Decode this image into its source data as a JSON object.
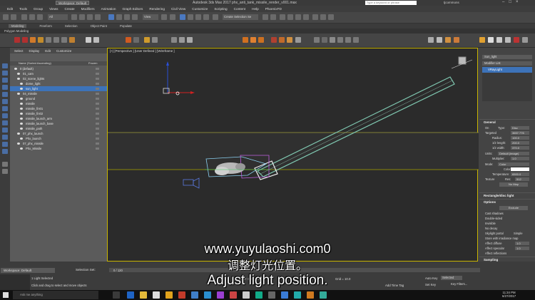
{
  "title_bar": {
    "workspace": "Workspace: Default",
    "title": "Autodesk 3ds Max 2017    phx_anti_tank_missile_render_v001.max",
    "search_placeholder": "Type a keyword or phrase",
    "user": "tjcommons",
    "controls": [
      "–",
      "□",
      "×"
    ]
  },
  "menu": [
    "Edit",
    "Tools",
    "Group",
    "Views",
    "Create",
    "Modifiers",
    "Animation",
    "Graph Editors",
    "Rendering",
    "Civil View",
    "Customize",
    "Scripting",
    "Content",
    "Help",
    "PhoenixFD"
  ],
  "toolbar": {
    "view_dropdown": "All",
    "coord_dropdown": "View",
    "selection_set": "Create Selection Se"
  },
  "ribbon": {
    "tabs": [
      "Modeling",
      "Freeform",
      "Selection",
      "Object Paint",
      "Populate"
    ],
    "active": "Modeling",
    "sub": "Polygon Modeling"
  },
  "scene_explorer": {
    "tabs": [
      "Select",
      "Display",
      "Edit",
      "Customize"
    ],
    "header_name": "Name (Sorted Ascending)",
    "header_frozen": "Frozen",
    "rows": [
      {
        "label": "0 (default)",
        "indent": 0,
        "selected": false
      },
      {
        "label": "01_cam",
        "indent": 1,
        "selected": false
      },
      {
        "label": "02_scene_lights",
        "indent": 1,
        "selected": true
      },
      {
        "label": "dome_light",
        "indent": 2,
        "selected": false
      },
      {
        "label": "sun_light",
        "indent": 2,
        "selected": true
      },
      {
        "label": "04_missile",
        "indent": 1,
        "selected": false
      },
      {
        "label": "ground",
        "indent": 2,
        "selected": false
      },
      {
        "label": "missile",
        "indent": 2,
        "selected": false
      },
      {
        "label": "missile_fin01",
        "indent": 2,
        "selected": false
      },
      {
        "label": "missile_fin02",
        "indent": 2,
        "selected": false
      },
      {
        "label": "missile_launch_arm",
        "indent": 2,
        "selected": false
      },
      {
        "label": "missile_launch_base",
        "indent": 2,
        "selected": false
      },
      {
        "label": "missile_path",
        "indent": 2,
        "selected": false
      },
      {
        "label": "07_phx_launch",
        "indent": 1,
        "selected": false
      },
      {
        "label": "Phx_launch",
        "indent": 2,
        "selected": false
      },
      {
        "label": "07_phx_missile",
        "indent": 1,
        "selected": false
      },
      {
        "label": "Phx_Missile",
        "indent": 2,
        "selected": false
      }
    ]
  },
  "viewport": {
    "label": "[+] [Perspective ] [User Defined ] [Wireframe ]"
  },
  "modify_panel": {
    "object_name": "Sun_light",
    "modifier_list": "Modifier List",
    "stack_item": "VRayLight",
    "general_title": "General",
    "on_label": "On",
    "type_label": "Type:",
    "type_value": "Disc",
    "targeted_label": "Targeted",
    "targeted_value": "3657.776",
    "radius_label": "Radius:",
    "radius_value": "100.0",
    "len_label": "1/2 length:",
    "len_value": "200.0",
    "width_label": "1/2 width:",
    "width_value": "370.0",
    "units_label": "Units:",
    "units_value": "Default (image)",
    "multiplier_label": "Multiplier:",
    "multiplier_value": "1.0",
    "mode_label": "Mode:",
    "mode_value": "Color",
    "color_label": "Color:",
    "temp_label": "Temperature:",
    "temp_value": "6500.0",
    "texture_label": "Texture",
    "res_label": "Res:",
    "res_value": "512",
    "nomap": "No Map",
    "rect_title": "Rectangle/disc light",
    "options_title": "Options",
    "exclude_button": "Exclude",
    "options": [
      "Cast shadows",
      "Double-sided",
      "Invisible",
      "No decay",
      "Skylight portal",
      "Store with irradiance map",
      "Affect diffuse",
      "Affect specular",
      "Affect reflections"
    ],
    "simple_label": "Simple",
    "affect_diffuse_value": "1.0",
    "affect_specular_value": "1.0",
    "sampling_title": "Sampling"
  },
  "bottom": {
    "workspace": "Workspace: Default",
    "selection_set": "Selection Set:",
    "frame": "0 / 120",
    "status1": "1 Light Selected",
    "status2": "Click and drag to select and move objects",
    "coords": "X: 0.0     Y: 0.0     Z: 0.0",
    "grid": "Grid = 10.0",
    "add_time_tag": "Add Time Tag",
    "auto_key": "Auto Key",
    "set_key": "Set Key",
    "selected": "Selected",
    "key_filters": "Key Filters..."
  },
  "taskbar": {
    "search": "Ask me anything",
    "time": "11:34 PM",
    "date": "6/27/2017"
  },
  "subtitles": {
    "url": "www.yuyulaoshi.com0",
    "chinese": "调整灯光位置。",
    "english": "Adjust light position."
  }
}
